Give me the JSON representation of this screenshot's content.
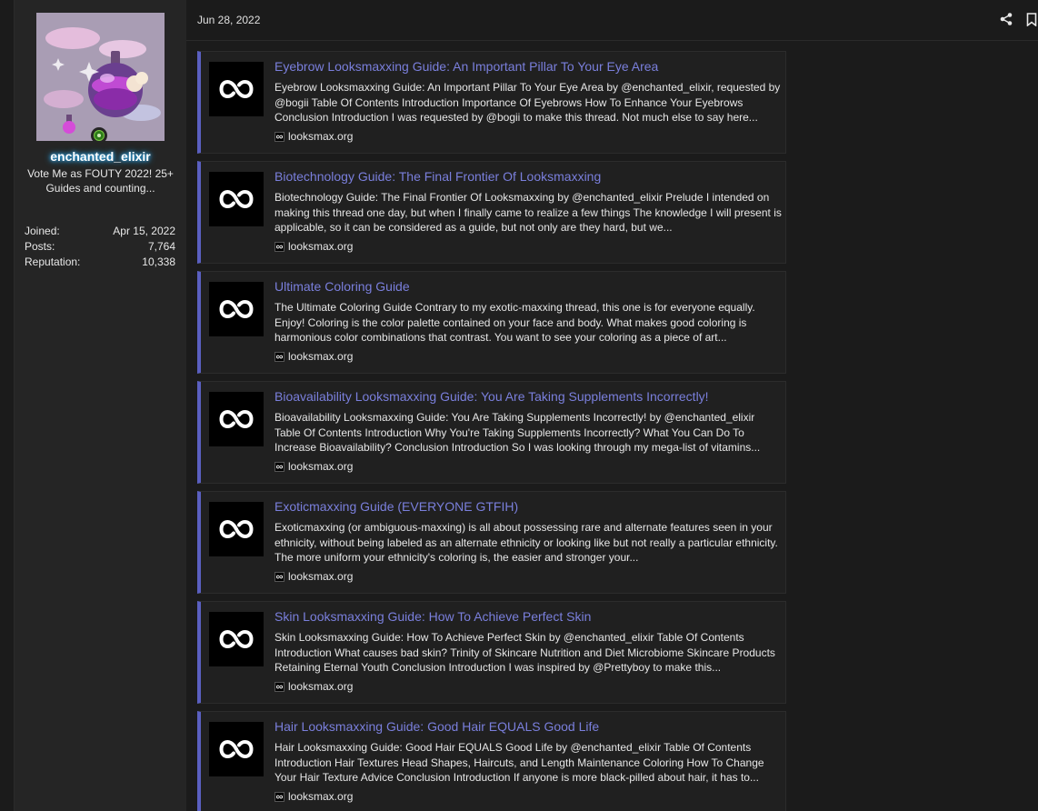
{
  "user": {
    "username": "enchanted_elixir",
    "title": "Vote Me as FOUTY 2022! 25+ Guides and counting...",
    "stats": [
      {
        "label": "Joined:",
        "value": "Apr 15, 2022"
      },
      {
        "label": "Posts:",
        "value": "7,764"
      },
      {
        "label": "Reputation:",
        "value": "10,338"
      }
    ]
  },
  "post": {
    "date": "Jun 28, 2022",
    "actions": [
      "share-icon",
      "bookmark-icon"
    ]
  },
  "embeds": [
    {
      "title": "Eyebrow Looksmaxxing Guide: An Important Pillar To Your Eye Area",
      "description": "Eyebrow Looksmaxxing Guide: An Important Pillar To Your Eye Area by @enchanted_elixir, requested by @bogii Table Of Contents Introduction Importance Of Eyebrows How To Enhance Your Eyebrows Conclusion Introduction I was requested by @bogii to make this thread. Not much else to say here...",
      "domain": "looksmax.org"
    },
    {
      "title": "Biotechnology Guide: The Final Frontier Of Looksmaxxing",
      "description": "Biotechnology Guide: The Final Frontier Of Looksmaxxing by @enchanted_elixir Prelude I intended on making this thread one day, but when I finally came to realize a few things The knowledge I will present is applicable, so it can be considered as a guide, but not only are they hard, but we...",
      "domain": "looksmax.org"
    },
    {
      "title": "Ultimate Coloring Guide",
      "description": "The Ultimate Coloring Guide Contrary to my exotic-maxxing thread, this one is for everyone equally. Enjoy! Coloring is the color palette contained on your face and body. What makes good coloring is harmonious color combinations that contrast. You want to see your coloring as a piece of art...",
      "domain": "looksmax.org"
    },
    {
      "title": "Bioavailability Looksmaxxing Guide: You Are Taking Supplements Incorrectly!",
      "description": "Bioavailability Looksmaxxing Guide: You Are Taking Supplements Incorrectly! by @enchanted_elixir Table Of Contents Introduction Why You're Taking Supplements Incorrectly? What You Can Do To Increase Bioavailability? Conclusion Introduction So I was looking through my mega-list of vitamins...",
      "domain": "looksmax.org"
    },
    {
      "title": "Exoticmaxxing Guide (EVERYONE GTFIH)",
      "description": "Exoticmaxxing (or ambiguous-maxxing) is all about possessing rare and alternate features seen in your ethnicity, without being labeled as an alternate ethnicity or looking like but not really a particular ethnicity. The more uniform your ethnicity's coloring is, the easier and stronger your...",
      "domain": "looksmax.org"
    },
    {
      "title": "Skin Looksmaxxing Guide: How To Achieve Perfect Skin",
      "description": "Skin Looksmaxxing Guide: How To Achieve Perfect Skin by @enchanted_elixir Table Of Contents Introduction What causes bad skin? Trinity of Skincare Nutrition and Diet Microbiome Skincare Products Retaining Eternal Youth Conclusion Introduction I was inspired by @Prettyboy to make this...",
      "domain": "looksmax.org"
    },
    {
      "title": "Hair Looksmaxxing Guide: Good Hair EQUALS Good Life",
      "description": "Hair Looksmaxxing Guide: Good Hair EQUALS Good Life by @enchanted_elixir Table Of Contents Introduction Hair Textures Head Shapes, Haircuts, and Length Maintenance Coloring How To Change Your Hair Texture Advice Conclusion Introduction If anyone is more black-pilled about hair, it has to...",
      "domain": "looksmax.org"
    }
  ],
  "colors": {
    "accent": "#5a5fc0",
    "link": "#7a7fdc",
    "background": "#1b1b1b",
    "panel": "#252525",
    "online": "#2e7d1a"
  }
}
